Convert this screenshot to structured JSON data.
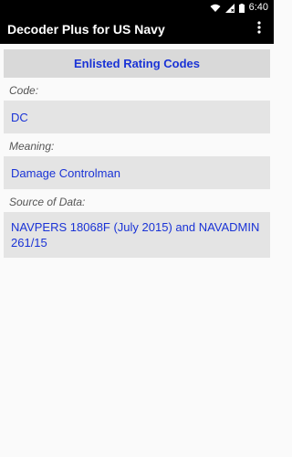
{
  "status_bar": {
    "time": "6:40"
  },
  "app_bar": {
    "title": "Decoder Plus for US Navy",
    "menu_icon": "more-vert-icon"
  },
  "main": {
    "header": "Enlisted Rating Codes",
    "fields": [
      {
        "label": "Code:",
        "value": "DC"
      },
      {
        "label": "Meaning:",
        "value": "Damage Controlman"
      },
      {
        "label": "Source of Data:",
        "value": "NAVPERS 18068F (July 2015) and NAVADMIN 261/15"
      }
    ]
  },
  "colors": {
    "accent": "#1a33d6",
    "app_bar": "#000000",
    "header_bg": "#d9d9d9",
    "value_bg": "#e4e4e4"
  }
}
